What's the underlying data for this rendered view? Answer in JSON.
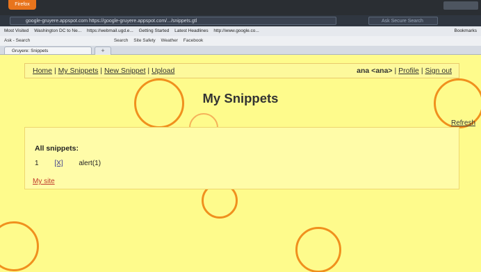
{
  "browser": {
    "app_button": "Firefox",
    "url": "google-gruyere.appspot.com  https://google-gruyere.appspot.com/.../snippets.gtl",
    "search_placeholder": "Ask Secure Search",
    "bookmarks": [
      "Most Visited",
      "Washington DC to Ne...",
      "https://webmail.ugd.e...",
      "Getting Started",
      "Latest Headlines",
      "http://www.google.co..."
    ],
    "bookmarks_menu": "Bookmarks",
    "toolbar": {
      "ask_label": "Ask - Search",
      "search_label": "Search",
      "site_safety": "Site Safety",
      "weather": "Weather",
      "facebook": "Facebook"
    },
    "tab_label": "Gruyere: Snippets",
    "new_tab": "+"
  },
  "page": {
    "menu": {
      "home": "Home",
      "sep1": "|",
      "my_snippets": "My Snippets",
      "sep2": "|",
      "new_snippet": "New Snippet",
      "sep3": "|",
      "upload": "Upload",
      "user": "ana <ana>",
      "sep4": "|",
      "profile": "Profile",
      "sep5": "|",
      "sign_out": "Sign out"
    },
    "title": "My Snippets",
    "refresh": "Refresh",
    "panel": {
      "heading": "All snippets:",
      "snippets": [
        {
          "index": "1",
          "delete_label": "[X]",
          "text": "alert(1)"
        }
      ],
      "my_site": "My site"
    },
    "colors": {
      "background": "#fefb8c",
      "circle": "#f0901e"
    }
  }
}
